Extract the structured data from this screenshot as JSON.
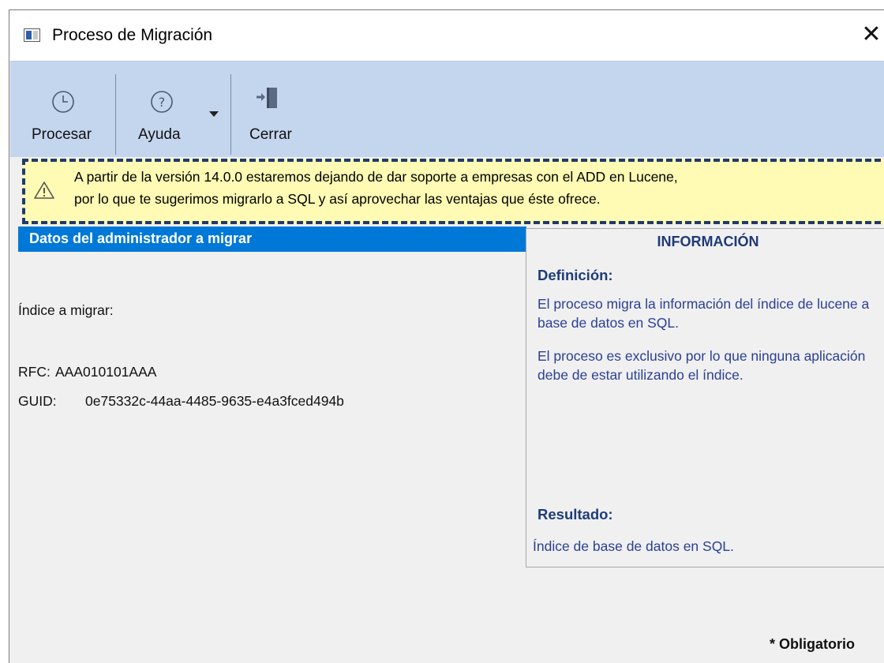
{
  "window": {
    "title": "Proceso de Migración",
    "close_glyph": "✕"
  },
  "toolbar": {
    "process_label": "Procesar",
    "help_label": "Ayuda",
    "close_label": "Cerrar"
  },
  "warning": {
    "line1": "A partir de la versión 14.0.0 estaremos dejando de dar soporte a empresas con el ADD en Lucene,",
    "line2": "por lo que te sugerimos migrarlo a SQL y así aprovechar las ventajas que éste ofrece."
  },
  "admin": {
    "header": "Datos del administrador a migrar",
    "index_label": "Índice a migrar:",
    "rfc_label": "RFC:",
    "rfc_value": "AAA010101AAA",
    "guid_label": "GUID:",
    "guid_value": "0e75332c-44aa-4485-9635-e4a3fced494b"
  },
  "info": {
    "title": "INFORMACIÓN",
    "definition_heading": "Definición:",
    "definition_p1": "El proceso migra la información del índice de lucene a base de datos en SQL.",
    "definition_p2": "El proceso es exclusivo por lo que ninguna aplicación debe de estar utilizando el índice.",
    "result_heading": "Resultado:",
    "result_text": "Índice de base de datos en SQL."
  },
  "footer": {
    "required_note": "* Obligatorio"
  },
  "icons": {
    "process": "clock-icon",
    "help": "help-circle-icon",
    "dropdown": "caret-down-icon",
    "close": "exit-door-icon",
    "warning": "warning-triangle-icon",
    "app": "window-app-icon"
  },
  "colors": {
    "ribbon": "#c4d5ee",
    "section_header": "#0078d7",
    "warning_bg": "#fffab4",
    "warning_border": "#1f3b6a",
    "info_text": "#2b3f95"
  }
}
